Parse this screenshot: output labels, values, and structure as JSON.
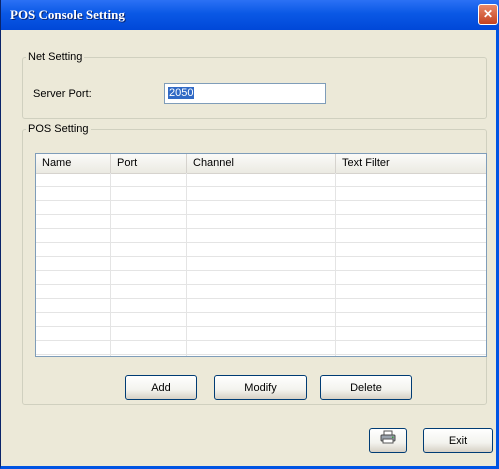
{
  "window": {
    "title": "POS Console Setting",
    "close_label": "✕"
  },
  "net_setting": {
    "legend": "Net Setting",
    "server_port_label": "Server Port:",
    "server_port_value": "2050"
  },
  "pos_setting": {
    "legend": "POS Setting",
    "columns": [
      "Name",
      "Port",
      "Channel",
      "Text Filter"
    ],
    "rows": []
  },
  "buttons": {
    "add": "Add",
    "modify": "Modify",
    "delete": "Delete",
    "exit": "Exit"
  },
  "icons": {
    "print": "printer-icon",
    "close": "close-icon"
  },
  "colors": {
    "titlebar": "#0a58e5",
    "dialog_bg": "#ece9d8",
    "selection": "#316ac5"
  }
}
